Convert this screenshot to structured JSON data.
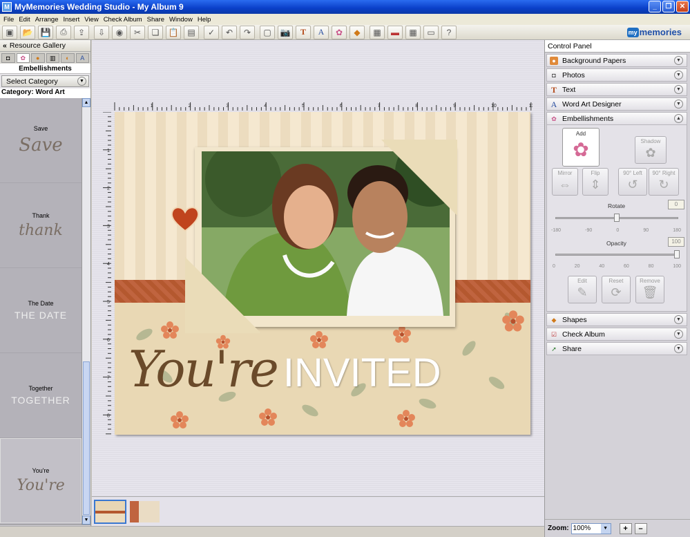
{
  "window": {
    "title": "MyMemories Wedding Studio - My Album 9",
    "controls": [
      "_",
      "❐",
      "✕"
    ]
  },
  "menu": [
    "File",
    "Edit",
    "Arrange",
    "Insert",
    "View",
    "Check Album",
    "Share",
    "Window",
    "Help"
  ],
  "toolbar": {
    "buttons": [
      "toolbar-icon",
      "open-icon",
      "save-icon",
      "print-icon",
      "export-icon",
      "import-icon",
      "preview-icon",
      "cut-icon",
      "copy-icon",
      "paste-icon",
      "paste-special-icon",
      "spellcheck-icon",
      "undo-icon",
      "redo-icon",
      "new-page-icon",
      "camera-icon",
      "text-icon",
      "word-art-icon",
      "embellishment-icon",
      "shapes-icon",
      "photo-import-icon",
      "album-icon",
      "grid-icon",
      "film-icon",
      "help-icon"
    ],
    "brand_prefix": "my",
    "brand_name": "memories"
  },
  "resource_gallery": {
    "header": "Resource Gallery",
    "tabs": [
      "camera-icon",
      "flower-icon",
      "palette-icon",
      "layout-icon",
      "paint-icon",
      "text-icon"
    ],
    "section_title": "Embellishments",
    "category_select": "Select Category",
    "category_label": "Category: Word Art",
    "items": [
      {
        "label": "Save",
        "art": "Save",
        "style": "script"
      },
      {
        "label": "Thank",
        "art": "thank",
        "style": "script"
      },
      {
        "label": "The Date",
        "art": "THE DATE",
        "style": "caps"
      },
      {
        "label": "Together",
        "art": "TOGETHER",
        "style": "caps"
      },
      {
        "label": "You're",
        "art": "You're",
        "style": "script"
      }
    ]
  },
  "canvas": {
    "ruler_h_ticks": [
      "1",
      "2",
      "3",
      "4",
      "5",
      "6",
      "7",
      "8",
      "9",
      "10",
      "11"
    ],
    "ruler_v_ticks": [
      "1",
      "2",
      "3",
      "4",
      "5",
      "6",
      "7",
      "8"
    ],
    "invite_script": "You're",
    "invite_caps": "INVITED"
  },
  "control_panel": {
    "title": "Control Panel",
    "sections_top": [
      {
        "label": "Background Papers",
        "icon": "palette-icon"
      },
      {
        "label": "Photos",
        "icon": "camera-icon"
      },
      {
        "label": "Text",
        "icon": "text-icon"
      },
      {
        "label": "Word Art Designer",
        "icon": "word-art-icon"
      },
      {
        "label": "Embellishments",
        "icon": "flower-icon"
      }
    ],
    "embellishments": {
      "add": "Add",
      "shadow": "Shadow",
      "mirror": "Mirror",
      "flip": "Flip",
      "rotate_left": "90° Left",
      "rotate_right": "90° Right",
      "rotate_label": "Rotate",
      "rotate_value": "0",
      "rotate_ticks": [
        "-180",
        "-90",
        "0",
        "90",
        "180"
      ],
      "opacity_label": "Opacity",
      "opacity_value": "100",
      "opacity_ticks": [
        "0",
        "20",
        "40",
        "60",
        "80",
        "100"
      ],
      "edit": "Edit",
      "reset": "Reset",
      "remove": "Remove"
    },
    "sections_bottom": [
      {
        "label": "Shapes",
        "icon": "shapes-icon"
      },
      {
        "label": "Check Album",
        "icon": "check-icon"
      },
      {
        "label": "Share",
        "icon": "share-icon"
      }
    ]
  },
  "zoom": {
    "label": "Zoom:",
    "value": "100%",
    "plus": "+",
    "minus": "–"
  }
}
